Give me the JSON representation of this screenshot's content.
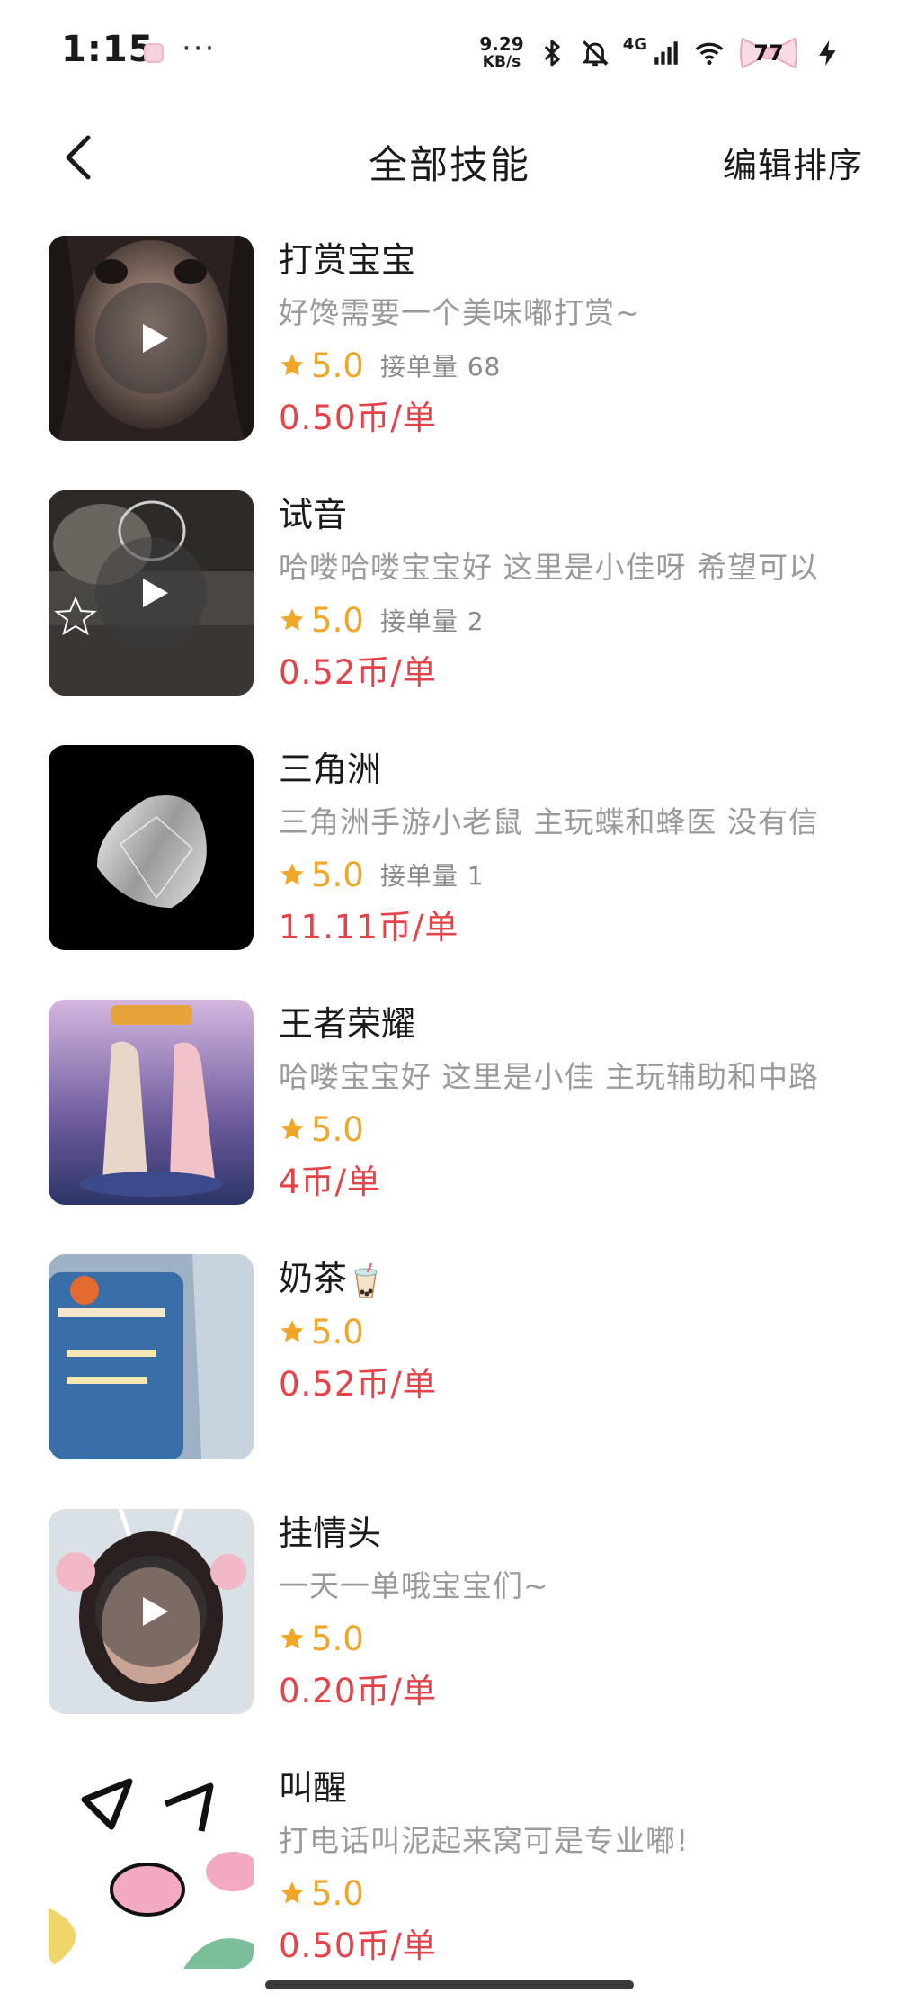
{
  "status_bar": {
    "time": "1:15",
    "dots": "···",
    "speed_value": "9.29",
    "speed_unit": "KB/s",
    "network": "4G",
    "battery": "77",
    "icons": [
      "bluetooth-icon",
      "mute-bell-icon",
      "signal-icon",
      "wifi-icon",
      "charging-icon"
    ]
  },
  "header": {
    "title": "全部技能",
    "action": "编辑排序"
  },
  "skills": [
    {
      "name": "打赏宝宝",
      "desc": "好馋需要一个美味嘟打赏~",
      "score": "5.0",
      "orders": "接单量 68",
      "price": "0.50币/单",
      "video": true
    },
    {
      "name": "试音",
      "desc": "哈喽哈喽宝宝好 这里是小佳呀 希望可以",
      "score": "5.0",
      "orders": "接单量 2",
      "price": "0.52币/单",
      "video": true
    },
    {
      "name": "三角洲",
      "desc": "三角洲手游小老鼠 主玩蝶和蜂医 没有信",
      "score": "5.0",
      "orders": "接单量 1",
      "price": "11.11币/单",
      "video": false
    },
    {
      "name": "王者荣耀",
      "desc": "哈喽宝宝好 这里是小佳 主玩辅助和中路",
      "score": "5.0",
      "orders": "",
      "price": "4币/单",
      "video": false
    },
    {
      "name": "奶茶",
      "desc": "",
      "score": "5.0",
      "orders": "",
      "price": "0.52币/单",
      "video": false
    },
    {
      "name": "挂情头",
      "desc": "一天一单哦宝宝们~",
      "score": "5.0",
      "orders": "",
      "price": "0.20币/单",
      "video": true
    },
    {
      "name": "叫醒",
      "desc": "打电话叫泥起来窝可是专业嘟!",
      "score": "5.0",
      "orders": "",
      "price": "0.50币/单",
      "video": false
    }
  ],
  "colors": {
    "price": "#e5434a",
    "star": "#f0a629",
    "desc": "#9a9a9a"
  }
}
